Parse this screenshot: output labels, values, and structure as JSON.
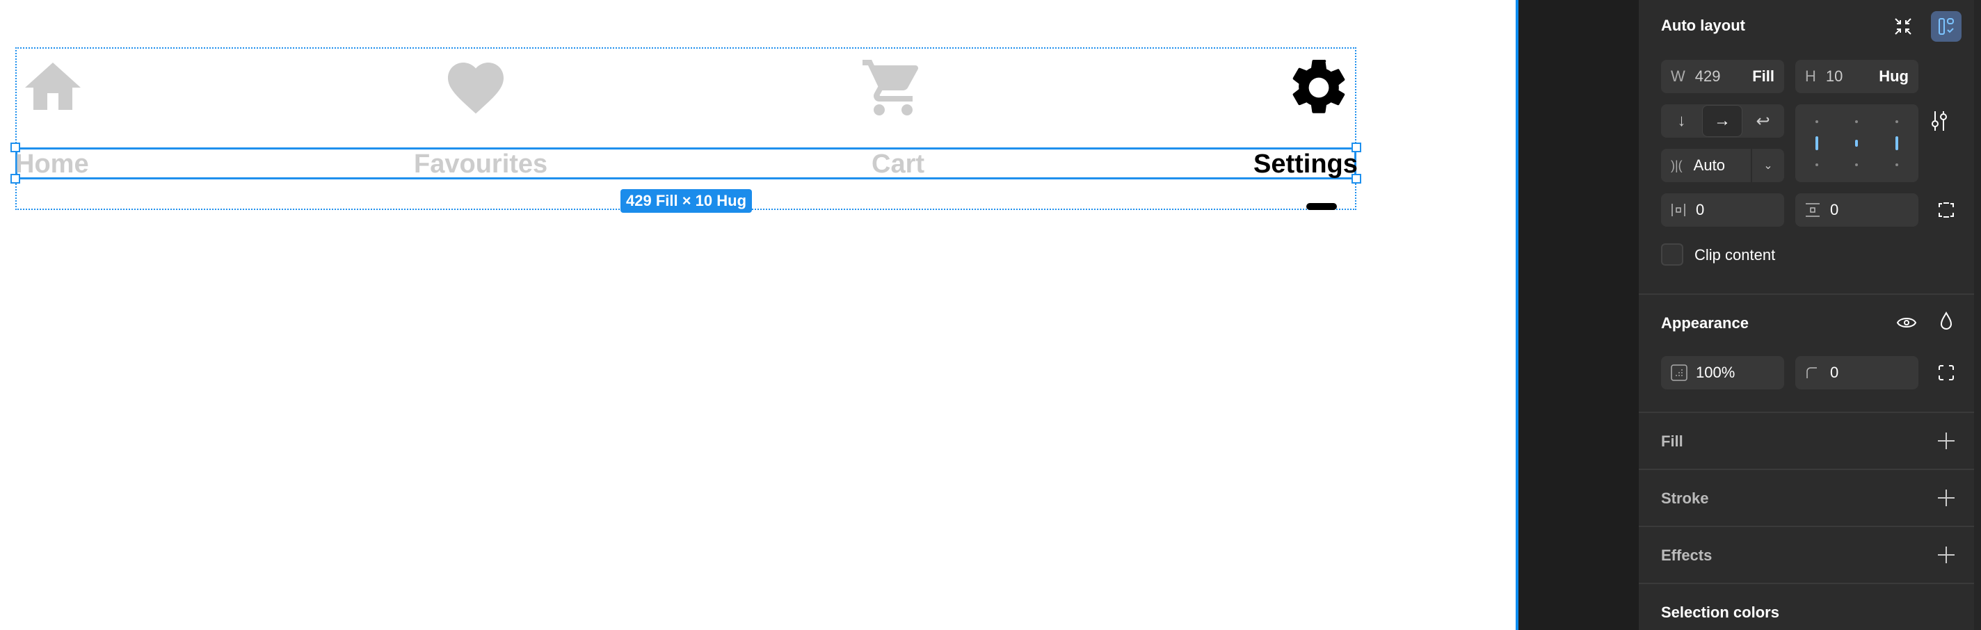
{
  "canvas": {
    "nav_items": [
      {
        "label": "Home",
        "icon": "home-icon",
        "active": false
      },
      {
        "label": "Favourites",
        "icon": "heart-icon",
        "active": false
      },
      {
        "label": "Cart",
        "icon": "cart-icon",
        "active": false
      },
      {
        "label": "Settings",
        "icon": "gear-icon",
        "active": true
      }
    ],
    "size_badge": "429 Fill × 10 Hug",
    "colors": {
      "inactive": "#cccccc",
      "active": "#000000",
      "selection": "#1b8ceb"
    }
  },
  "panel": {
    "auto_layout": {
      "title": "Auto layout",
      "width_label": "W",
      "width_value": "429",
      "width_mode": "Fill",
      "height_label": "H",
      "height_value": "10",
      "height_mode": "Hug",
      "direction": "horizontal",
      "gap_value": "Auto",
      "padding_horizontal": "0",
      "padding_vertical": "0",
      "clip_content_label": "Clip content",
      "clip_content": false
    },
    "appearance": {
      "title": "Appearance",
      "opacity": "100%",
      "corner_radius": "0"
    },
    "fill": {
      "title": "Fill"
    },
    "stroke": {
      "title": "Stroke"
    },
    "effects": {
      "title": "Effects"
    },
    "selection_colors": {
      "title": "Selection colors"
    }
  }
}
